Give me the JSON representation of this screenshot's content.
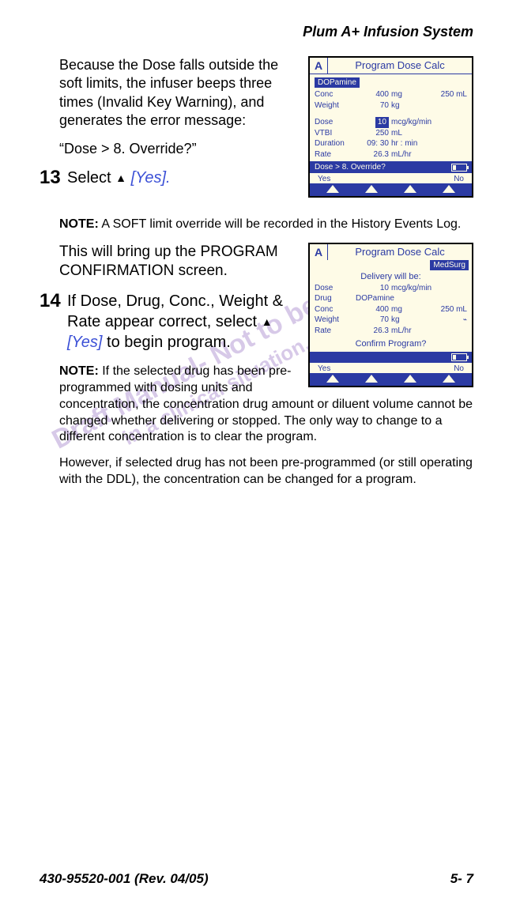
{
  "header": {
    "title": "Plum A+ Infusion System"
  },
  "intro": {
    "p1": "Because the Dose falls outside the soft limits, the infuser beeps three times (Invalid Key Warning), and generates the error message:",
    "p2": "“Dose > 8. Override?”"
  },
  "step13": {
    "num": "13",
    "textA": "Select ",
    "glyph": "▲",
    "yes": "[Yes].",
    "note_label": "NOTE:",
    "note_text": " A SOFT limit override will be recorded in the History Events Log.",
    "after": "This will bring up the PROGRAM CONFIRMATION screen."
  },
  "step14": {
    "num": "14",
    "textA": "If Dose, Drug, Conc., Weight & Rate appear correct, select ",
    "glyph": "▲",
    "yes": "[Yes]",
    "textB": " to begin program.",
    "note_label": "NOTE:",
    "note_text": " If the selected drug has been pre-programmed with dosing units and concentration, the concentration drug amount or diluent volume cannot be changed whether delivering or stopped. The only way to change to a different concentration is to clear the program.",
    "note2": "However, if selected drug has not been pre-programmed (or still operating with the DDL), the concentration can be changed for a program."
  },
  "screen1": {
    "channel": "A",
    "title": "Program Dose Calc",
    "drug_tag": "DOPamine",
    "rows_top": [
      {
        "label": "Conc",
        "value": "400",
        "unit": "mg",
        "extra": "250 mL"
      },
      {
        "label": "Weight",
        "value": "70",
        "unit": "kg",
        "extra": ""
      }
    ],
    "rows_mid": [
      {
        "label": "Dose",
        "value": "10",
        "unit": "mcg/kg/min",
        "hl": true
      },
      {
        "label": "VTBI",
        "value": "250",
        "unit": "mL"
      },
      {
        "label": "Duration",
        "value": "09: 30",
        "unit": "hr : min"
      },
      {
        "label": "Rate",
        "value": "26.3",
        "unit": "mL/hr"
      }
    ],
    "status": "Dose > 8. Override?",
    "soft_left": "Yes",
    "soft_right": "No"
  },
  "screen2": {
    "channel": "A",
    "title": "Program Dose Calc",
    "chip": "MedSurg",
    "delivery": "Delivery will be:",
    "rows": [
      {
        "label": "Dose",
        "value": "10",
        "unit": "mcg/kg/min",
        "extra": ""
      },
      {
        "label": "Drug",
        "value": "DOPamine",
        "unit": "",
        "extra": ""
      },
      {
        "label": "Conc",
        "value": "400",
        "unit": "mg",
        "extra": "250 mL"
      },
      {
        "label": "Weight",
        "value": "70",
        "unit": "kg",
        "extra": "⌁"
      },
      {
        "label": "Rate",
        "value": "26.3",
        "unit": "mL/hr",
        "extra": ""
      }
    ],
    "confirm": "Confirm Program?",
    "soft_left": "Yes",
    "soft_right": "No"
  },
  "watermark": {
    "line1": "Draft Manual- Not to be used",
    "line2": "in a clinical situation."
  },
  "footer": {
    "left": "430-95520-001 (Rev. 04/05)",
    "right": "5- 7"
  }
}
